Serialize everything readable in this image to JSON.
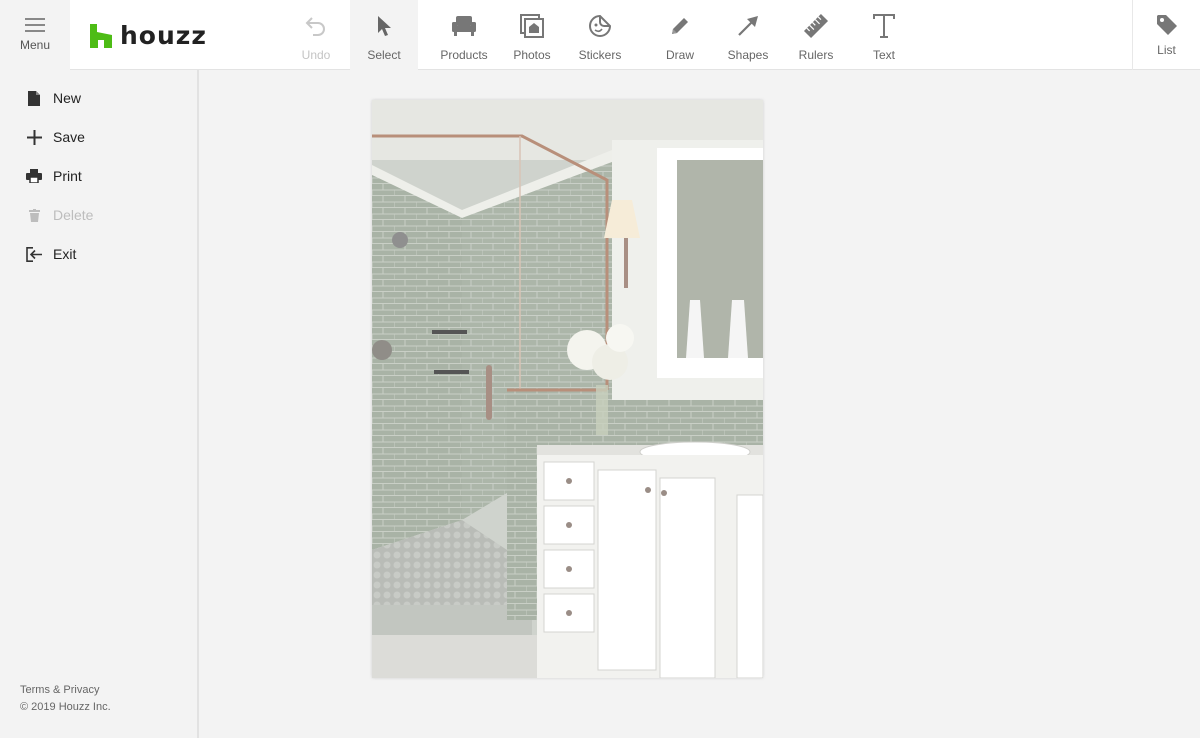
{
  "header": {
    "menu_label": "Menu",
    "logo_text": "houzz",
    "brand_color": "#4dbc15",
    "tools": [
      {
        "id": "undo",
        "label": "Undo",
        "icon": "undo-icon",
        "disabled": true
      },
      {
        "id": "select",
        "label": "Select",
        "icon": "cursor-icon",
        "active": true
      },
      {
        "id": "products",
        "label": "Products",
        "icon": "armchair-icon"
      },
      {
        "id": "photos",
        "label": "Photos",
        "icon": "photo-house-icon"
      },
      {
        "id": "stickers",
        "label": "Stickers",
        "icon": "sticker-icon"
      },
      {
        "id": "draw",
        "label": "Draw",
        "icon": "pencil-icon"
      },
      {
        "id": "shapes",
        "label": "Shapes",
        "icon": "arrow-icon"
      },
      {
        "id": "rulers",
        "label": "Rulers",
        "icon": "ruler-icon"
      },
      {
        "id": "text",
        "label": "Text",
        "icon": "text-icon"
      }
    ],
    "list_label": "List"
  },
  "sidebar": {
    "items": [
      {
        "id": "new",
        "label": "New",
        "icon": "document-icon"
      },
      {
        "id": "save",
        "label": "Save",
        "icon": "plus-icon"
      },
      {
        "id": "print",
        "label": "Print",
        "icon": "printer-icon"
      },
      {
        "id": "delete",
        "label": "Delete",
        "icon": "trash-icon",
        "disabled": true
      },
      {
        "id": "exit",
        "label": "Exit",
        "icon": "exit-icon"
      }
    ],
    "footer": {
      "terms": "Terms & Privacy",
      "copyright": "© 2019 Houzz Inc."
    }
  }
}
